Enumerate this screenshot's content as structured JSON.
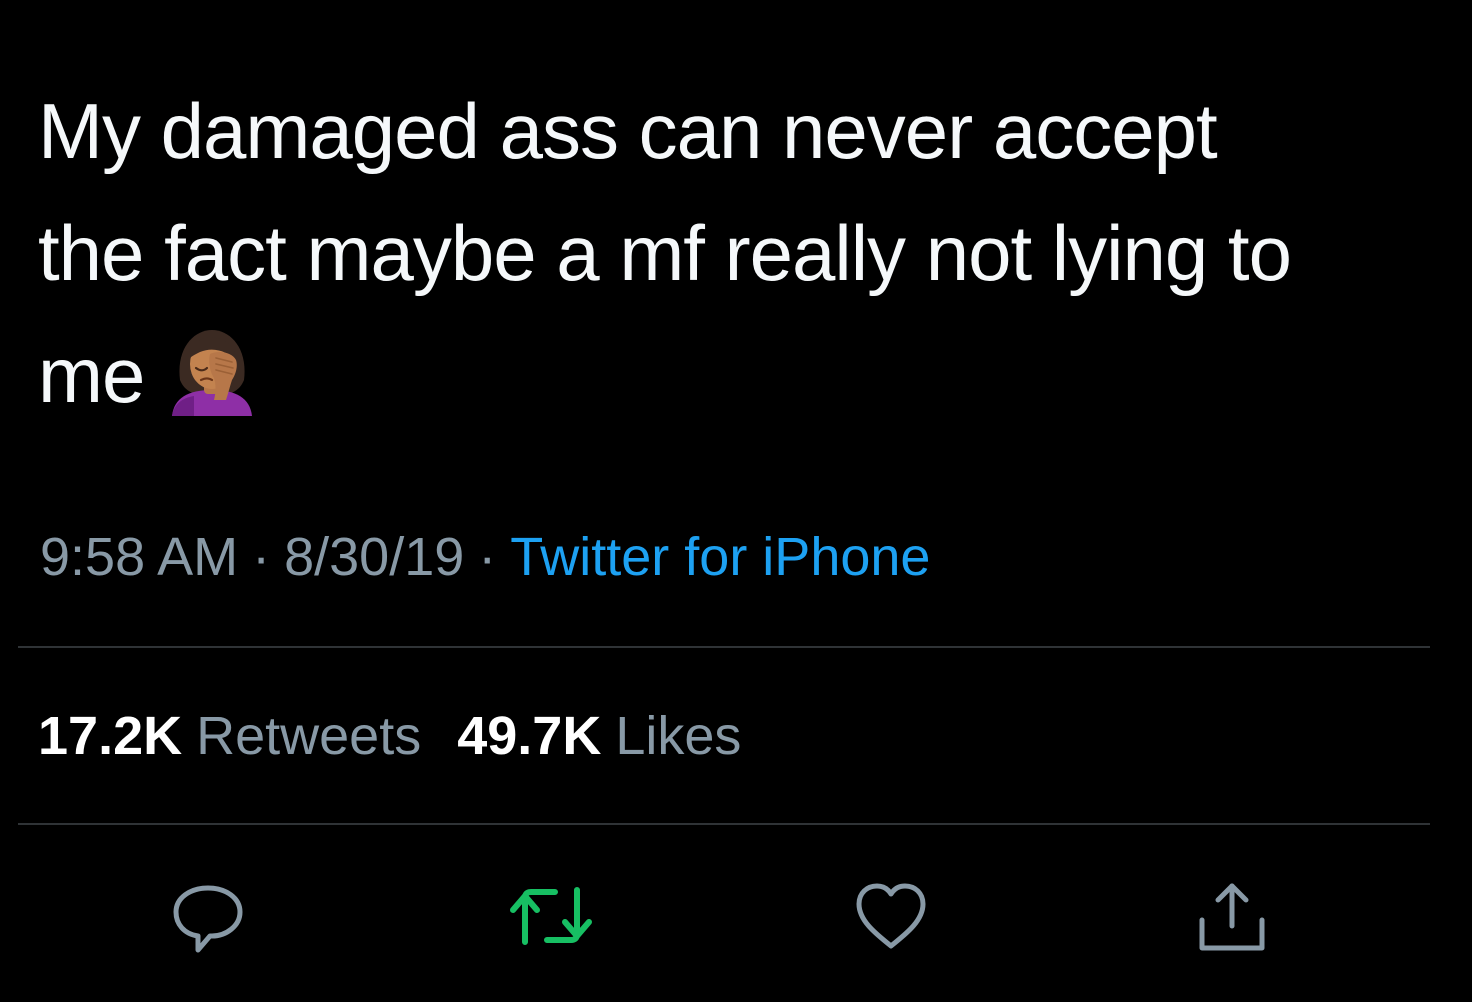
{
  "tweet": {
    "text_lines": [
      "My damaged ass can never accept",
      "the fact maybe a mf really not lying to",
      "me"
    ],
    "emoji": "woman-facepalming-emoji",
    "time": "9:58 AM",
    "separator": "·",
    "date": "8/30/19",
    "source": "Twitter for iPhone"
  },
  "stats": {
    "retweets_count": "17.2K",
    "retweets_label": "Retweets",
    "likes_count": "49.7K",
    "likes_label": "Likes"
  },
  "actions": {
    "reply_icon": "reply-bubble-icon",
    "retweet_icon": "retweet-arrows-icon",
    "like_icon": "heart-icon",
    "share_icon": "share-upload-icon"
  },
  "colors": {
    "background": "#000000",
    "text": "#f5f8fa",
    "secondary": "#8899a6",
    "link": "#1da1f2",
    "retweet_active": "#17bf63",
    "divider": "#2f3336"
  }
}
